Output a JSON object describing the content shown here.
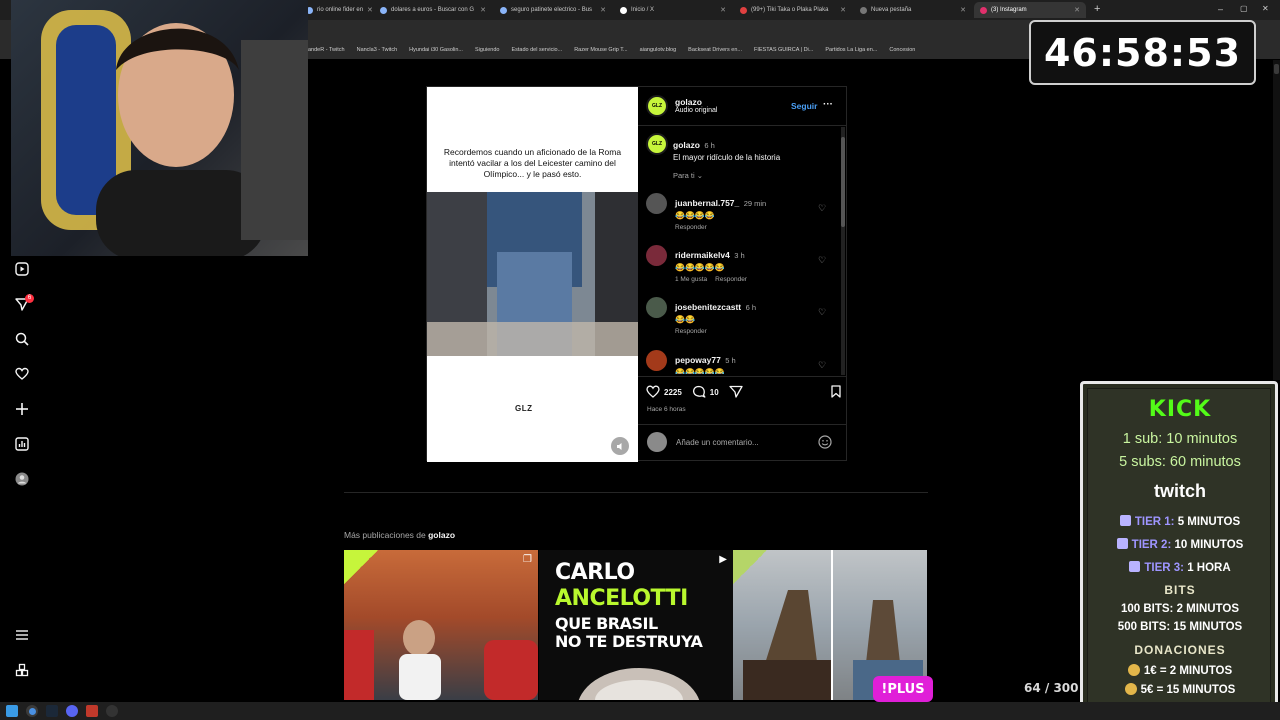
{
  "browser": {
    "tabs": [
      {
        "label": "rio online fider en"
      },
      {
        "label": "dolares a euros - Buscar con G"
      },
      {
        "label": "seguro patinete electrico - Bus"
      },
      {
        "label": "Inicio / X"
      },
      {
        "label": "(99+) Tiki Taka o Plaka Plaka"
      },
      {
        "label": "Nueva pestaña"
      },
      {
        "label": "(3) Instagram"
      }
    ],
    "bookmarks": [
      "andeR - Twitch",
      "Nancla3 - Twitch",
      "Hyundai i30 Gasolin...",
      "Siguiendo",
      "Estado del servicio...",
      "Razer Mouse Grip T...",
      "aiangulotv.blog",
      "Backseat Drivers en...",
      "FIESTAS GUIRCA | Di...",
      "Partidos La Liga en...",
      "Concesion"
    ]
  },
  "post": {
    "media_caption": "Recordemos cuando un aficionado de la Roma intentó vacilar a los del Leicester camino del Olímpico... y le pasó esto.",
    "watermark": "GLZ",
    "author": "golazo",
    "author_avatar_text": "GLZ",
    "audio": "Audio original",
    "follow_label": "Seguir",
    "more_label": "···",
    "description_user": "golazo",
    "description_time": "6 h",
    "description_text": "El mayor ridículo de la historia",
    "filter_label": "Para ti",
    "comments": [
      {
        "user": "juanbernal.757_",
        "time": "29 min",
        "text": "😂😂😂😂",
        "actions": [
          "Responder"
        ]
      },
      {
        "user": "ridermaikelv4",
        "time": "3 h",
        "text": "😂😂😂😂😂",
        "actions": [
          "1 Me gusta",
          "Responder"
        ]
      },
      {
        "user": "josebenitezcastt",
        "time": "6 h",
        "text": "😂😂",
        "actions": [
          "Responder"
        ]
      },
      {
        "user": "pepoway77",
        "time": "5 h",
        "text": "😂😂😂😂😂",
        "actions": []
      }
    ],
    "likes": "2225",
    "comments_count": "10",
    "posted_ago": "Hace 6 horas",
    "comment_placeholder": "Añade un comentario..."
  },
  "more_posts": {
    "prefix": "Más publicaciones de ",
    "author": "golazo",
    "thumb2_lines": [
      "CARLO",
      "ANCELOTTI",
      "QUE BRASIL",
      "NO TE DESTRUYA"
    ]
  },
  "overlay": {
    "timer": "46:58:53",
    "kick_title": "KICK",
    "kick_lines": [
      "1 sub: 10 minutos",
      "5 subs: 60 minutos"
    ],
    "twitch_title": "twitch",
    "tiers": [
      {
        "label": "TIER 1:",
        "value": "5 MINUTOS"
      },
      {
        "label": "TIER 2:",
        "value": "10 MINUTOS"
      },
      {
        "label": "TIER 3:",
        "value": "1 HORA"
      }
    ],
    "bits_title": "BITS",
    "bits_lines": [
      "100 BITS: 2 MINUTOS",
      "500 BITS: 15 MINUTOS"
    ],
    "donations_title": "DONACIONES",
    "donation_lines": [
      "1€ = 2 MINUTOS",
      "5€ = 15 MINUTOS"
    ],
    "plus_badge": "!PLUS",
    "counter": "64 / 300"
  },
  "colors": {
    "accent_blue": "#4a9ff5",
    "brand_lime": "#c6f53b",
    "kick_green": "#53fc18",
    "plus_magenta": "#e01fd8"
  },
  "icons": {
    "sidebar": [
      "reels-icon",
      "messages-icon",
      "search-icon",
      "heart-icon",
      "create-icon",
      "stats-icon",
      "profile-icon",
      "menu-icon",
      "apps-icon"
    ]
  }
}
